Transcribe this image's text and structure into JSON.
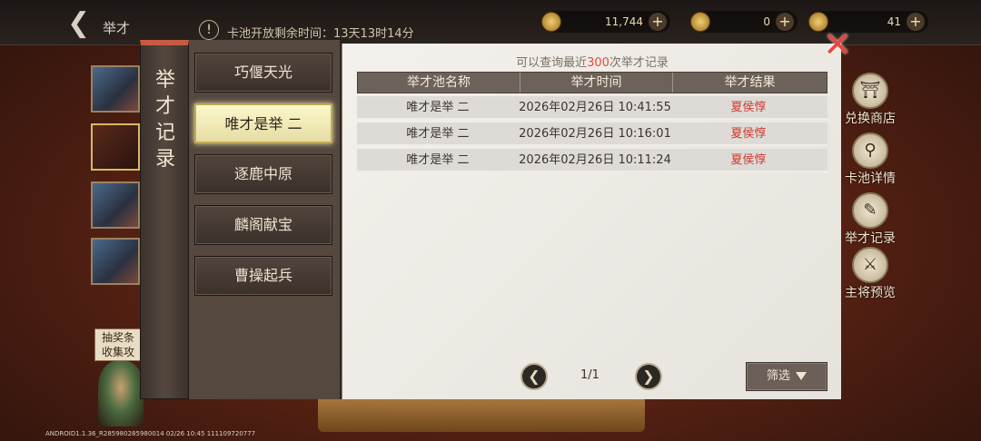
{
  "header": {
    "back_title": "举才",
    "notice_text": "卡池开放剩余时间：13天13时14分",
    "resources": [
      {
        "value": "11,744"
      },
      {
        "value": "0"
      },
      {
        "value": "41"
      }
    ]
  },
  "right_menu": [
    {
      "label": "兑换商店",
      "icon": "shop-icon"
    },
    {
      "label": "卡池详情",
      "icon": "magnifier-icon"
    },
    {
      "label": "举才记录",
      "icon": "brush-icon"
    },
    {
      "label": "主将预览",
      "icon": "hero-icon"
    }
  ],
  "guide_text_1": "抽奖条",
  "guide_text_2": "收集攻",
  "version": "ANDROID1.1.36_R285980285980014 02/26 10:45 111109720777",
  "dialog": {
    "title": "举才记录",
    "tabs": [
      "巧偃天光",
      "唯才是举 二",
      "逐鹿中原",
      "麟阁献宝",
      "曹操起兵"
    ],
    "active_tab_index": 1,
    "notice_prefix": "可以查询最近",
    "notice_count": "300",
    "notice_suffix": "次举才记录",
    "columns": [
      "举才池名称",
      "举才时间",
      "举才结果"
    ],
    "rows": [
      {
        "pool": "唯才是举 二",
        "time": "2026年02月26日 10:41:55",
        "result": "夏侯惇"
      },
      {
        "pool": "唯才是举 二",
        "time": "2026年02月26日 10:16:01",
        "result": "夏侯惇"
      },
      {
        "pool": "唯才是举 二",
        "time": "2026年02月26日 10:11:24",
        "result": "夏侯惇"
      }
    ],
    "page": "1/1",
    "filter_label": "筛选",
    "close_icon": "close-icon"
  }
}
